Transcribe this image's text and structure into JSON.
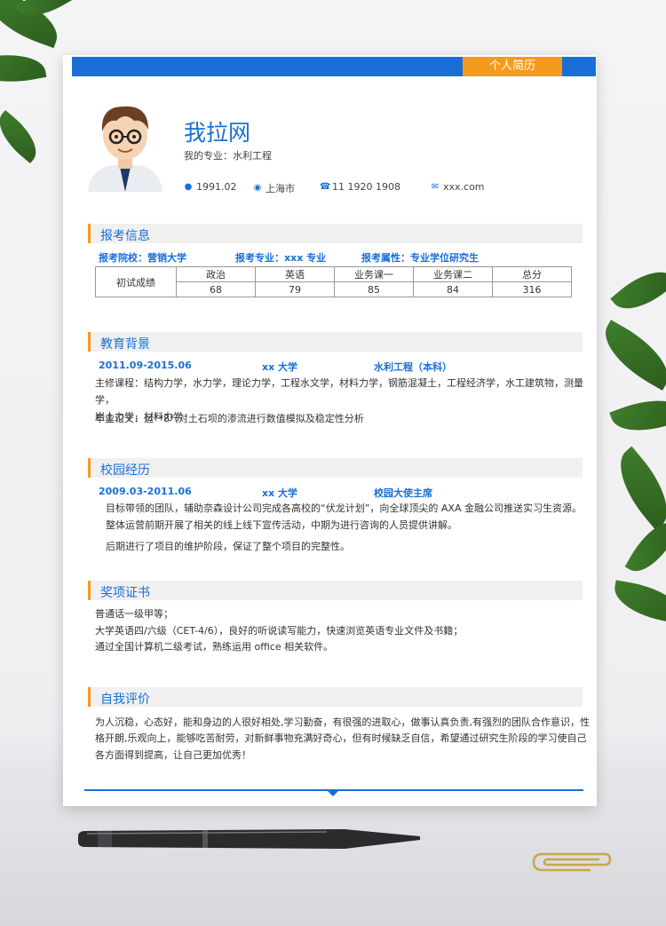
{
  "header": {
    "tag": "个人简历"
  },
  "profile": {
    "name": "我拉网",
    "major": "我的专业：水利工程",
    "birth": "1991.02",
    "city": "上海市",
    "phone": "11 1920 1908",
    "email": "xxx.com"
  },
  "exam": {
    "title": "报考信息",
    "school": "报考院校：营销大学",
    "major": "报考专业：xxx 专业",
    "attr": "报考属性：专业学位研究生",
    "row_label": "初试成绩",
    "headers": [
      "政治",
      "英语",
      "业务课一",
      "业务课二",
      "总分"
    ],
    "scores": [
      "68",
      "79",
      "85",
      "84",
      "316"
    ]
  },
  "education": {
    "title": "教育背景",
    "period": "2011.09-2015.06",
    "school": "xx 大学",
    "major": "水利工程（本科）",
    "courses_1": "主修课程：结构力学，水力学，理论力学，工程水文学，材料力学，钢筋混凝土，工程经济学，水工建筑物，测量学，",
    "courses_2": "岩土力学，材料力学",
    "thesis": "毕业论文：运**8*(对土石坝的渗流进行数值模拟及稳定性分析"
  },
  "campus": {
    "title": "校园经历",
    "period": "2009.03-2011.06",
    "school": "xx 大学",
    "role": "校园大使主席",
    "line1": "目标带领的团队，辅助奈森设计公司完成各高校的“伏龙计划”，向全球顶尖的 AXA 金融公司推送实习生资源。",
    "line2": "整体运营前期开展了相关的线上线下宣传活动，中期为进行咨询的人员提供讲解。",
    "line3": "后期进行了项目的维护阶段，保证了整个项目的完整性。"
  },
  "awards": {
    "title": "奖项证书",
    "line1": "普通话一级甲等；",
    "line2": "大学英语四/六级（CET-4/6），良好的听说读写能力，快速浏览英语专业文件及书籍；",
    "line3": "通过全国计算机二级考试，熟练运用 office 相关软件。"
  },
  "self": {
    "title": "自我评价",
    "line1": "为人沉稳，心态好，能和身边的人很好相处,学习勤奋，有很强的进取心，做事认真负责,有强烈的团队合作意识，性",
    "line2": "格开朗,乐观向上，能够吃苦耐劳，对新鲜事物充满好奇心，但有时候缺乏自信，希望通过研究生阶段的学习使自己",
    "line3": "各方面得到提高，让自己更加优秀！"
  },
  "colors": {
    "accent": "#1a6fd6",
    "highlight": "#f59b1b"
  },
  "icons": [
    "person-icon",
    "location-pin-icon",
    "phone-icon",
    "mail-icon"
  ]
}
